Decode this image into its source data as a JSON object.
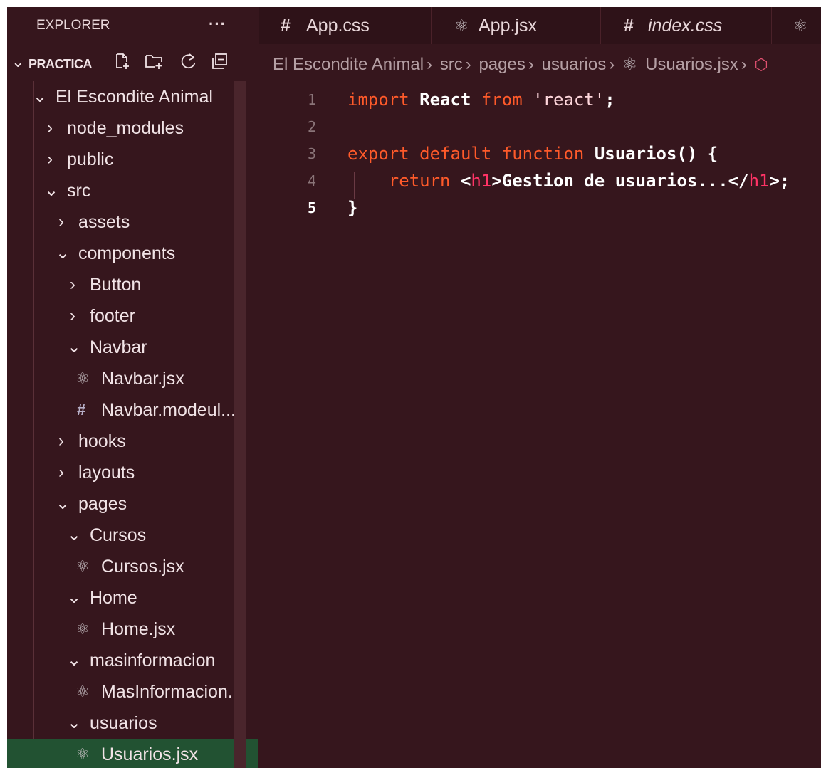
{
  "sidebar": {
    "title": "EXPLORER",
    "more": "···",
    "section": {
      "chevron": "chevron-down",
      "title": "PRACTICA",
      "actions": [
        "new-file-icon",
        "new-folder-icon",
        "refresh-icon",
        "collapse-all-icon"
      ]
    },
    "tree": [
      {
        "label": "El Escondite Animal",
        "kind": "folder",
        "expanded": true
      },
      {
        "label": "node_modules",
        "kind": "folder",
        "expanded": false
      },
      {
        "label": "public",
        "kind": "folder",
        "expanded": false
      },
      {
        "label": "src",
        "kind": "folder",
        "expanded": true
      },
      {
        "label": "assets",
        "kind": "folder",
        "expanded": false
      },
      {
        "label": "components",
        "kind": "folder",
        "expanded": true
      },
      {
        "label": "Button",
        "kind": "folder",
        "expanded": false
      },
      {
        "label": "footer",
        "kind": "folder",
        "expanded": false
      },
      {
        "label": "Navbar",
        "kind": "folder",
        "expanded": true
      },
      {
        "label": "Navbar.jsx",
        "kind": "react-file"
      },
      {
        "label": "Navbar.modeul...",
        "kind": "css-file"
      },
      {
        "label": "hooks",
        "kind": "folder",
        "expanded": false
      },
      {
        "label": "layouts",
        "kind": "folder",
        "expanded": false
      },
      {
        "label": "pages",
        "kind": "folder",
        "expanded": true
      },
      {
        "label": "Cursos",
        "kind": "folder",
        "expanded": true
      },
      {
        "label": "Cursos.jsx",
        "kind": "react-file"
      },
      {
        "label": "Home",
        "kind": "folder",
        "expanded": true
      },
      {
        "label": "Home.jsx",
        "kind": "react-file"
      },
      {
        "label": "masinformacion",
        "kind": "folder",
        "expanded": true
      },
      {
        "label": "MasInformacion...",
        "kind": "react-file"
      },
      {
        "label": "usuarios",
        "kind": "folder",
        "expanded": true
      },
      {
        "label": "Usuarios.jsx",
        "kind": "react-file",
        "selected": true
      }
    ]
  },
  "tabs": [
    {
      "label": "App.css",
      "icon": "#",
      "italic": false
    },
    {
      "label": "App.jsx",
      "icon": "react",
      "italic": false
    },
    {
      "label": "index.css",
      "icon": "#",
      "italic": true
    },
    {
      "label": "",
      "icon": "react",
      "italic": false
    }
  ],
  "breadcrumb": [
    "El Escondite Animal",
    "src",
    "pages",
    "usuarios",
    "Usuarios.jsx"
  ],
  "editor": {
    "lines": [
      {
        "num": "1"
      },
      {
        "num": "2"
      },
      {
        "num": "3"
      },
      {
        "num": "4"
      },
      {
        "num": "5",
        "active": true
      }
    ],
    "code": {
      "l1_kw1": "import",
      "l1_name": "React",
      "l1_kw2": "from",
      "l1_str": "'react'",
      "l1_end": ";",
      "l3_kw1": "export",
      "l3_kw2": "default",
      "l3_kw3": "function",
      "l3_fn": "Usuarios",
      "l3_end": "() {",
      "l4_kw": "return",
      "l4_open1": "<",
      "l4_tag1": "h1",
      "l4_open2": ">",
      "l4_text": "Gestion de usuarios...",
      "l4_close1": "</",
      "l4_tag2": "h1",
      "l4_close2": ">;",
      "l5": "}"
    }
  },
  "colors": {
    "background": "#36161d",
    "selection": "#225232",
    "keyword": "#ff5a2a",
    "tag": "#ff3366"
  }
}
